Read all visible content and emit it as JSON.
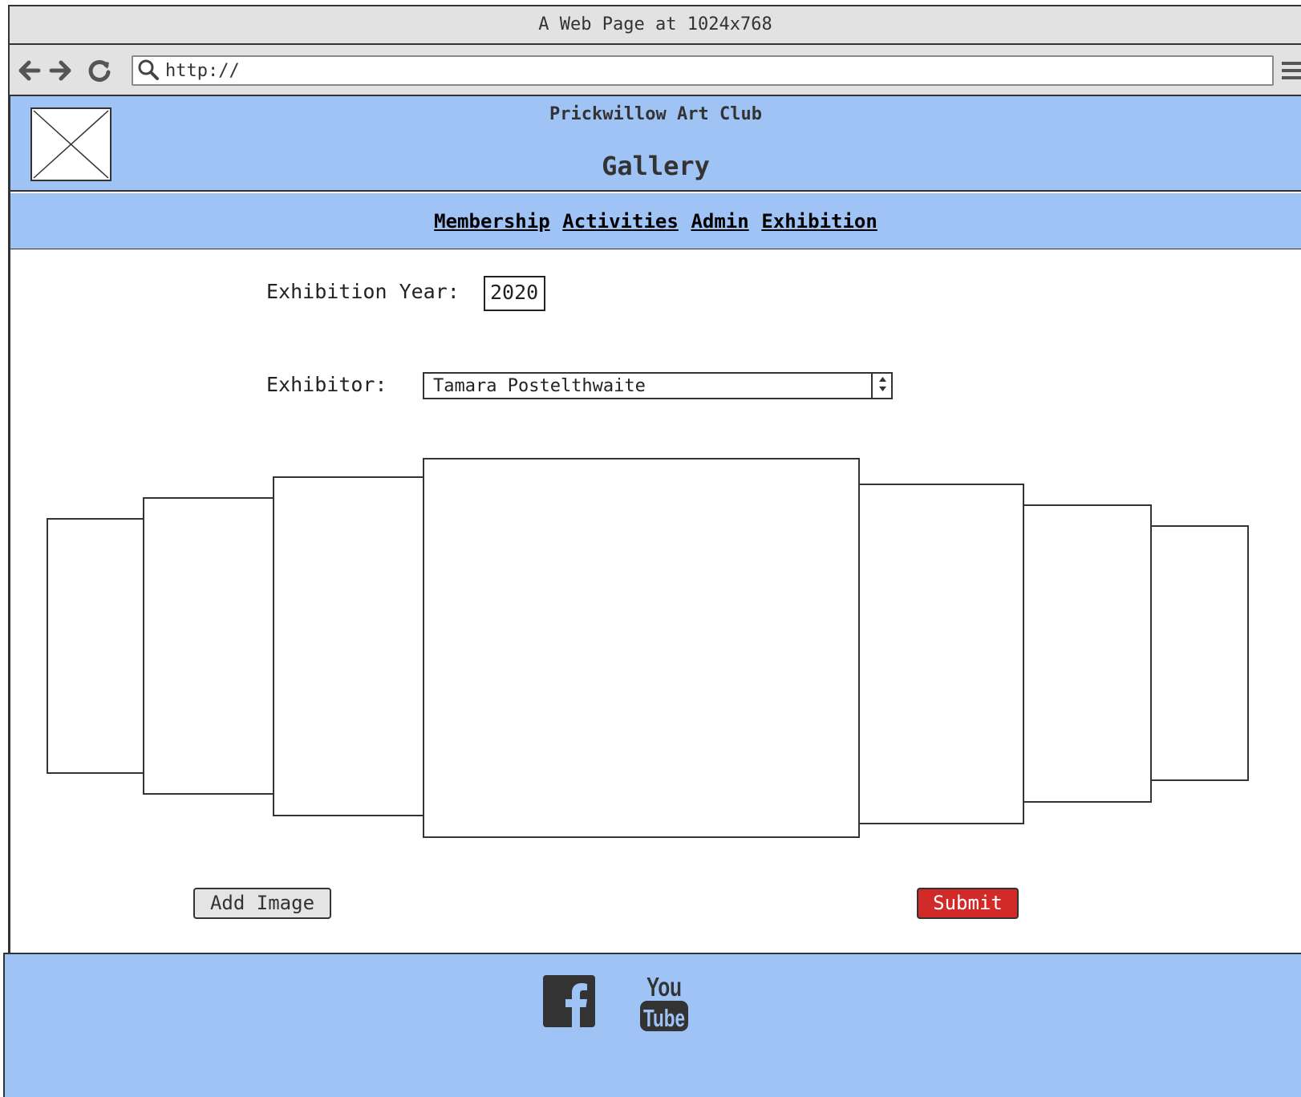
{
  "browser": {
    "window_title": "A Web Page at 1024x768",
    "url": "http://",
    "icons": [
      "back-arrow-icon",
      "forward-arrow-icon",
      "reload-icon",
      "search-icon",
      "hamburger-menu-icon"
    ]
  },
  "header": {
    "club_name": "Prickwillow Art Club",
    "page_title": "Gallery",
    "logo_icon": "image-placeholder-icon"
  },
  "menu": {
    "items": [
      {
        "label": "Membership"
      },
      {
        "label": "Activities"
      },
      {
        "label": "Admin"
      },
      {
        "label": "Exhibition"
      }
    ]
  },
  "form": {
    "year_label": "Exhibition Year:",
    "year_value": "2020",
    "exhibitor_label": "Exhibitor:",
    "exhibitor_selected": "Tamara Postelthwaite"
  },
  "gallery": {
    "frame_count": 7
  },
  "actions": {
    "add_image_label": "Add Image",
    "submit_label": "Submit"
  },
  "footer": {
    "icons": [
      "facebook-icon",
      "youtube-icon"
    ]
  },
  "colors": {
    "header_bg": "#a0c3f5",
    "submit_bg": "#d22a28",
    "chrome_bg": "#e2e2e2"
  }
}
